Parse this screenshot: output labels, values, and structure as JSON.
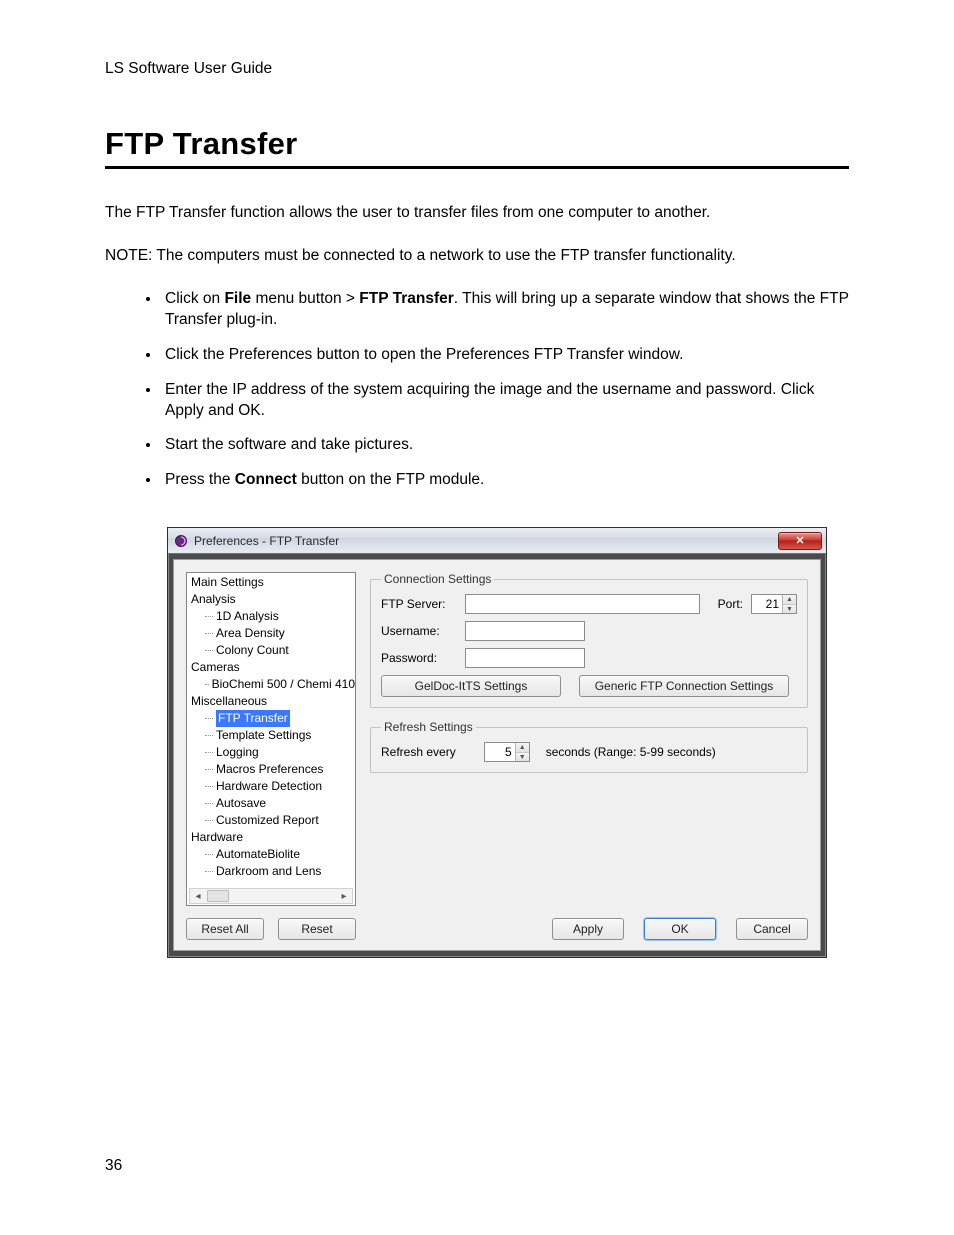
{
  "doc": {
    "header": "LS Software User Guide",
    "section_title": "FTP Transfer",
    "intro": "The FTP Transfer function allows the user to transfer files from one computer to another.",
    "note": "NOTE: The computers must be connected to a network to use the FTP transfer functionality.",
    "steps": {
      "s1_pre": "Click on ",
      "s1_file": "File",
      "s1_mid": " menu button > ",
      "s1_ftp": "FTP Transfer",
      "s1_post": ". This will bring up a separate window that shows the FTP Transfer plug-in.",
      "s2": "Click the Preferences button to open the Preferences FTP Transfer window.",
      "s3": "Enter the IP address of the system acquiring the image and the username and password. Click Apply and OK.",
      "s4": "Start the software and take pictures.",
      "s5_pre": "Press the ",
      "s5_connect": "Connect",
      "s5_post": " button on the FTP module."
    },
    "page_number": "36"
  },
  "dialog": {
    "title": "Preferences - FTP Transfer",
    "tree": {
      "main_settings": "Main Settings",
      "analysis": "Analysis",
      "analysis_items": {
        "a1": "1D Analysis",
        "a2": "Area Density",
        "a3": "Colony Count"
      },
      "cameras": "Cameras",
      "cameras_items": {
        "c1": "BioChemi 500 / Chemi 410"
      },
      "misc": "Miscellaneous",
      "misc_items": {
        "m1": "FTP Transfer",
        "m2": "Template Settings",
        "m3": "Logging",
        "m4": "Macros Preferences",
        "m5": "Hardware Detection",
        "m6": "Autosave",
        "m7": "Customized Report"
      },
      "hardware": "Hardware",
      "hardware_items": {
        "h1": "AutomateBiolite",
        "h2": "Darkroom and Lens"
      }
    },
    "buttons": {
      "reset_all": "Reset All",
      "reset": "Reset",
      "apply": "Apply",
      "ok": "OK",
      "cancel": "Cancel",
      "geldoc": "GelDoc-ItTS Settings",
      "generic_ftp": "Generic FTP Connection Settings"
    },
    "connection": {
      "legend": "Connection Settings",
      "ftp_server_label": "FTP Server:",
      "ftp_server_value": "",
      "port_label": "Port:",
      "port_value": "21",
      "username_label": "Username:",
      "username_value": "",
      "password_label": "Password:",
      "password_value": ""
    },
    "refresh": {
      "legend": "Refresh Settings",
      "label": "Refresh every",
      "value": "5",
      "suffix": "seconds (Range: 5-99 seconds)"
    }
  }
}
